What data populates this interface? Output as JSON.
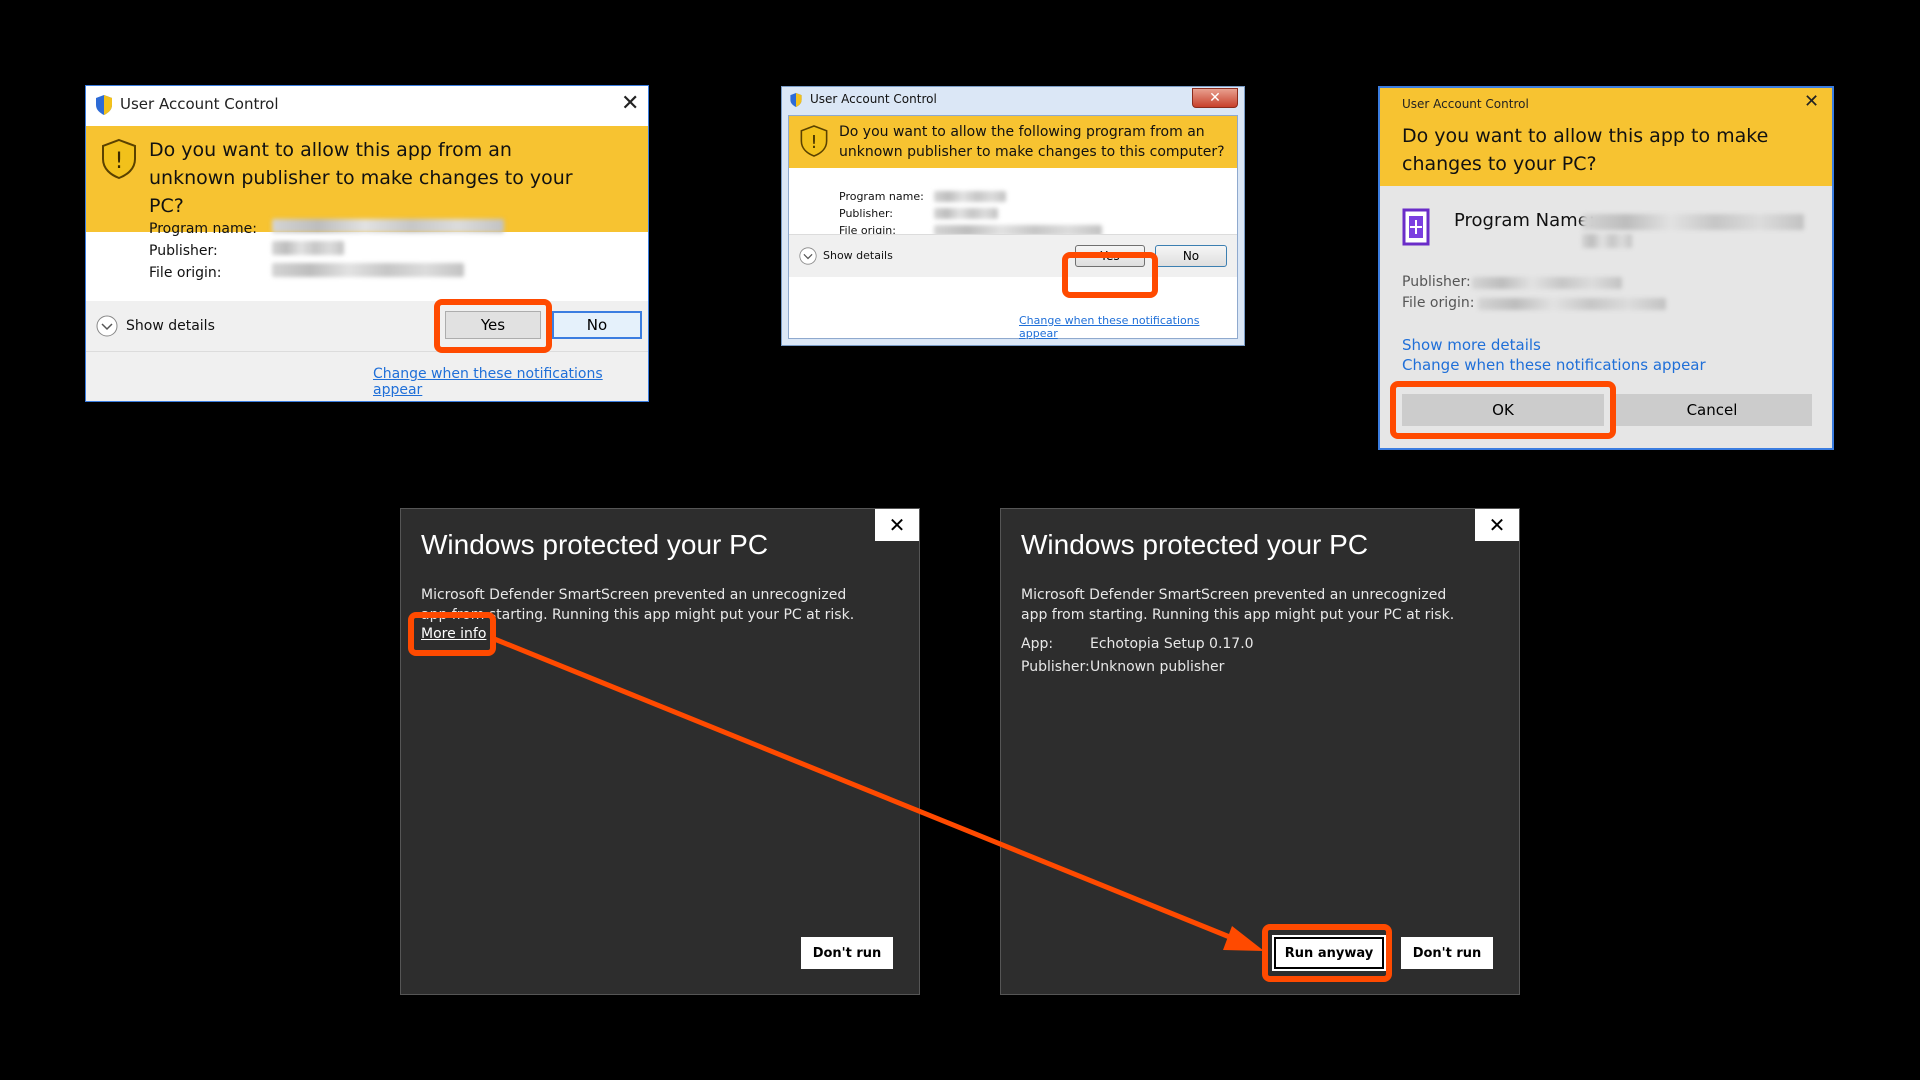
{
  "uac_win10": {
    "window_title": "User Account Control",
    "question": "Do you want to allow this app from an unknown publisher to make changes to your PC?",
    "labels": {
      "program_name": "Program name:",
      "publisher": "Publisher:",
      "file_origin": "File origin:"
    },
    "show_details": "Show details",
    "yes_label": "Yes",
    "no_label": "No",
    "change_link": "Change when these notifications appear",
    "icons": {
      "title": "uac-shield-icon",
      "warning": "warning-shield-icon",
      "details": "chevron-down-icon",
      "close": "close-icon"
    }
  },
  "uac_win7": {
    "window_title": "User Account Control",
    "question": "Do you want to allow the following program from an unknown publisher to make changes to this computer?",
    "labels": {
      "program_name": "Program name:",
      "publisher": "Publisher:",
      "file_origin": "File origin:"
    },
    "show_details": "Show details",
    "yes_label": "Yes",
    "no_label": "No",
    "change_link": "Change when these notifications appear",
    "close_glyph": "✕"
  },
  "uac_win8": {
    "window_title": "User Account Control",
    "question": "Do you want to allow this app to make changes to your PC?",
    "program_name_label": "Program Name:",
    "publisher_label": "Publisher:",
    "file_origin_label": "File origin:",
    "show_more": "Show more details",
    "change_link": "Change when these notifications appear",
    "ok_label": "OK",
    "cancel_label": "Cancel"
  },
  "smartscreen_initial": {
    "title": "Windows protected your PC",
    "message": "Microsoft Defender SmartScreen prevented an unrecognized app from starting. Running this app might put your PC at risk.",
    "more_info": "More info",
    "dont_run": "Don't run",
    "close_glyph": "✕"
  },
  "smartscreen_expanded": {
    "title": "Windows protected your PC",
    "message": "Microsoft Defender SmartScreen prevented an unrecognized app from starting. Running this app might put your PC at risk.",
    "app_label": "App:",
    "app_value": "Echotopia Setup 0.17.0",
    "publisher_label": "Publisher:",
    "publisher_value": "Unknown publisher",
    "run_anyway": "Run anyway",
    "dont_run": "Don't run",
    "close_glyph": "✕"
  },
  "annotation": {
    "highlight_color": "#ff4a00",
    "accent_yellow": "#f7c331",
    "link_blue": "#1f6fd8"
  }
}
